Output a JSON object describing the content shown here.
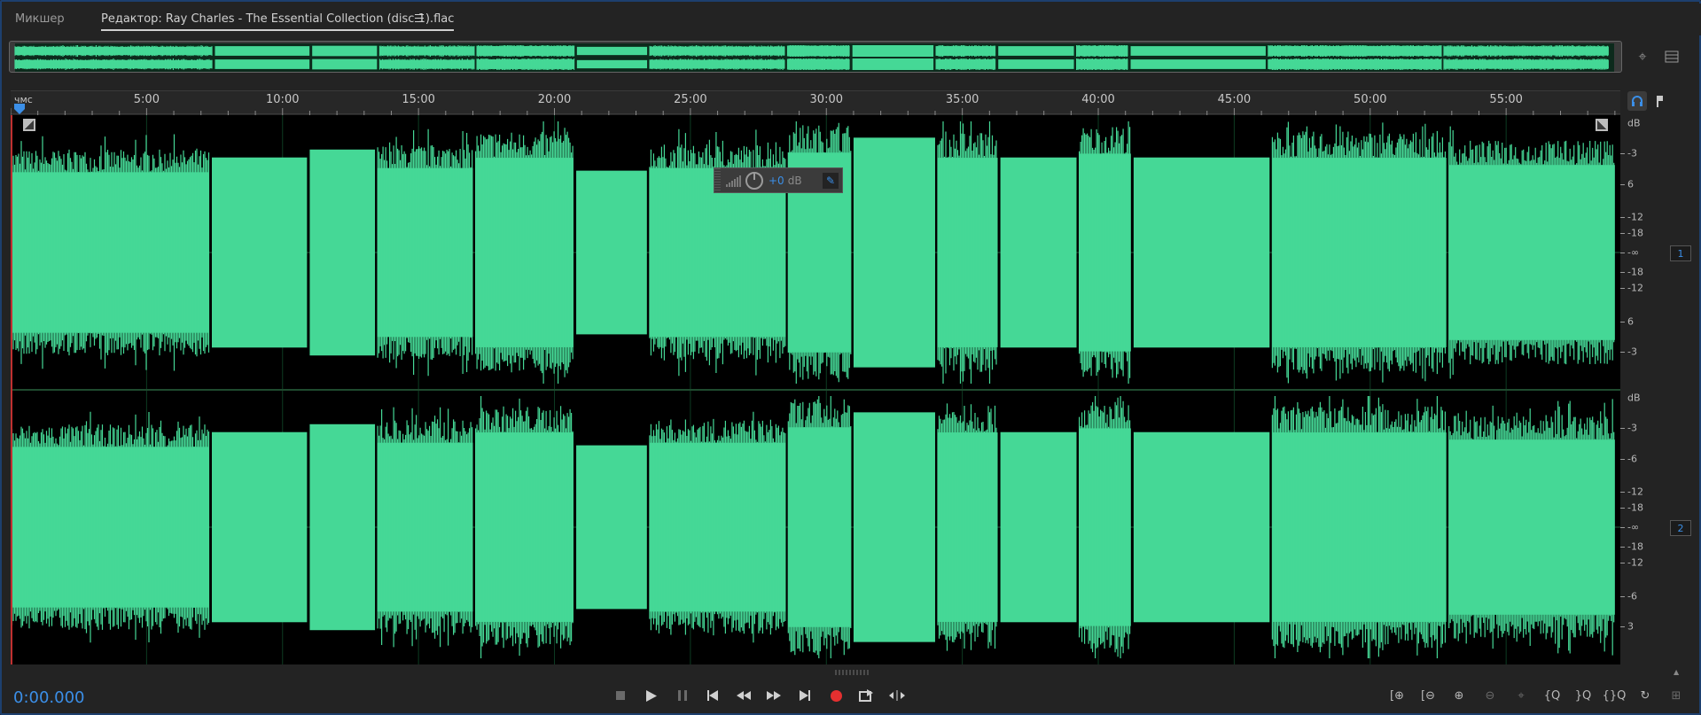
{
  "tabs": {
    "mixer": "Микшер",
    "editor": "Редактор: Ray Charles - The Essential Collection (disc 1).flac"
  },
  "ruler": {
    "unit": "чмс",
    "labels": [
      "5:00",
      "10:00",
      "15:00",
      "20:00",
      "25:00",
      "30:00",
      "35:00",
      "40:00",
      "45:00",
      "50:00",
      "55:00"
    ]
  },
  "hud": {
    "value": "+0",
    "unit": "dB"
  },
  "scales": {
    "channel_1": [
      "dB",
      "-3",
      "6",
      "-12",
      "-18",
      "-∞",
      "-18",
      "-12",
      "6",
      "-3"
    ],
    "channel_2": [
      "dB",
      "-3",
      "-6",
      "-12",
      "-18",
      "-∞",
      "-18",
      "-12",
      "-6",
      "3"
    ]
  },
  "channels": {
    "one": "1",
    "two": "2"
  },
  "transport": {
    "time": "0:00.000"
  },
  "colors": {
    "waveform": "#45d896",
    "background": "#000000",
    "accent": "#3b8fe8",
    "record": "#e53030"
  },
  "track_segments": [
    {
      "start": 0,
      "end": 7.3,
      "level": 0.78,
      "style": "dynamic"
    },
    {
      "start": 7.4,
      "end": 10.9,
      "level": 0.72,
      "style": "flat"
    },
    {
      "start": 11.0,
      "end": 13.4,
      "level": 0.78,
      "style": "flat"
    },
    {
      "start": 13.5,
      "end": 17.0,
      "level": 0.82,
      "style": "dynamic"
    },
    {
      "start": 17.1,
      "end": 20.7,
      "level": 0.92,
      "style": "dynamic"
    },
    {
      "start": 20.8,
      "end": 23.4,
      "level": 0.62,
      "style": "flat"
    },
    {
      "start": 23.5,
      "end": 28.5,
      "level": 0.82,
      "style": "dynamic"
    },
    {
      "start": 28.6,
      "end": 30.9,
      "level": 0.97,
      "style": "dynamic"
    },
    {
      "start": 31.0,
      "end": 34.0,
      "level": 0.87,
      "style": "flat"
    },
    {
      "start": 34.1,
      "end": 36.3,
      "level": 0.92,
      "style": "dynamic"
    },
    {
      "start": 36.4,
      "end": 39.2,
      "level": 0.72,
      "style": "flat"
    },
    {
      "start": 39.3,
      "end": 41.2,
      "level": 0.96,
      "style": "dynamic"
    },
    {
      "start": 41.3,
      "end": 46.3,
      "level": 0.72,
      "style": "flat"
    },
    {
      "start": 46.4,
      "end": 52.8,
      "level": 0.92,
      "style": "dynamic"
    },
    {
      "start": 52.9,
      "end": 59.0,
      "level": 0.85,
      "style": "dynamic"
    }
  ]
}
